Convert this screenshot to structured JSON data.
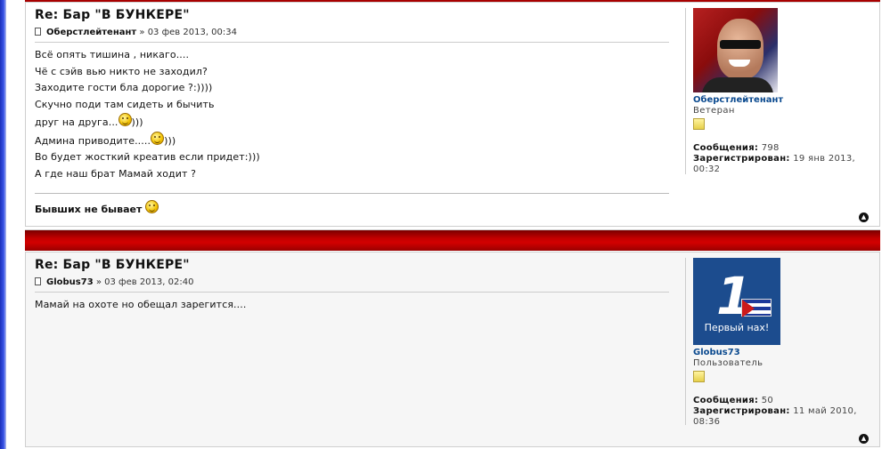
{
  "posts": [
    {
      "title": "Re: Бар \"В БУНКЕРЕ\"",
      "author": "Оберстлейтенант",
      "date": "» 03 фев 2013, 00:34",
      "lines": [
        "Всё опять тишина , никаго....",
        "Чё с сэйв вью никто не заходил?",
        "Заходите гости бла дорогие ?:))))",
        "Скучно поди там сидеть и бычить",
        "друг на друга...",
        ")))",
        "Админа приводите.....",
        ")))",
        "Во будет жосткий креатив если придет:)))",
        "А где наш брат Мамай ходит ?"
      ],
      "signature": "Бывших не бывает",
      "profile": {
        "username": "Оберстлейтенант",
        "rank": "Ветеран",
        "posts_label": "Сообщения:",
        "posts_value": "798",
        "registered_label": "Зарегистрирован:",
        "registered_value": "19 янв 2013, 00:32"
      }
    },
    {
      "title": "Re: Бар \"В БУНКЕРЕ\"",
      "author": "Globus73",
      "date": "» 03 фев 2013, 02:40",
      "lines": [
        "Мамай на охоте но обещал зарегится...."
      ],
      "profile": {
        "username": "Globus73",
        "avatar_caption": "Первый нах!",
        "rank": "Пользователь",
        "posts_label": "Сообщения:",
        "posts_value": "50",
        "registered_label": "Зарегистрирован:",
        "registered_value": "11 май 2010, 08:36"
      }
    }
  ],
  "icons": {
    "post": "document-icon",
    "top": "arrow-up-icon",
    "smiley": "smiley-icon",
    "rank": "rank-icon"
  },
  "colors": {
    "separator_red": "#c40000",
    "username_blue": "#0b4a8f"
  }
}
